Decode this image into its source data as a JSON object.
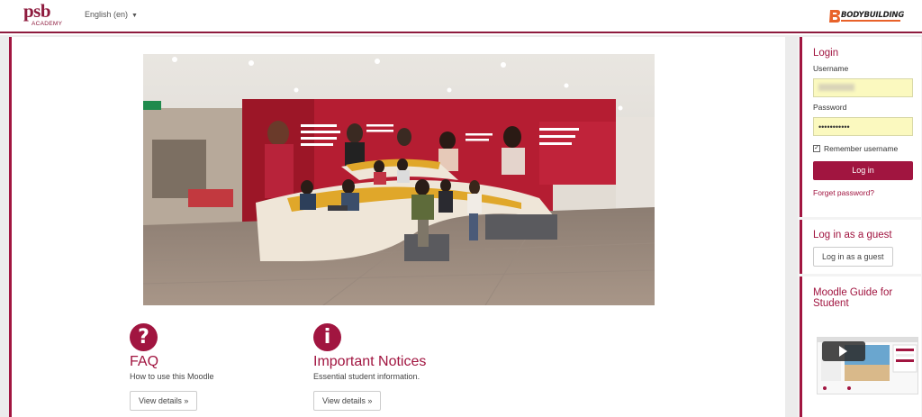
{
  "header": {
    "logo_main": "psb",
    "logo_sub": "ACADEMY",
    "language": "English (en)",
    "partner_brand": "BODYBUILDING"
  },
  "main": {
    "faq": {
      "icon": "question-icon",
      "glyph": "?",
      "title": "FAQ",
      "description": "How to use this Moodle",
      "button": "View details »"
    },
    "notices": {
      "icon": "info-icon",
      "glyph": "i",
      "title": "Important Notices",
      "description": "Essential student information.",
      "button": "View details »"
    }
  },
  "sidebar": {
    "login": {
      "title": "Login",
      "username_label": "Username",
      "username_value": "",
      "password_label": "Password",
      "password_value": "•••••••••••",
      "remember_label": "Remember username",
      "remember_checked": true,
      "login_button": "Log in",
      "forgot_link": "Forget password?"
    },
    "guest": {
      "title": "Log in as a guest",
      "button": "Log in as a guest"
    },
    "guide": {
      "title": "Moodle Guide for Student"
    }
  },
  "colors": {
    "brand": "#a11540",
    "autofill": "#fbf9bf",
    "partner_accent": "#e8622a"
  }
}
